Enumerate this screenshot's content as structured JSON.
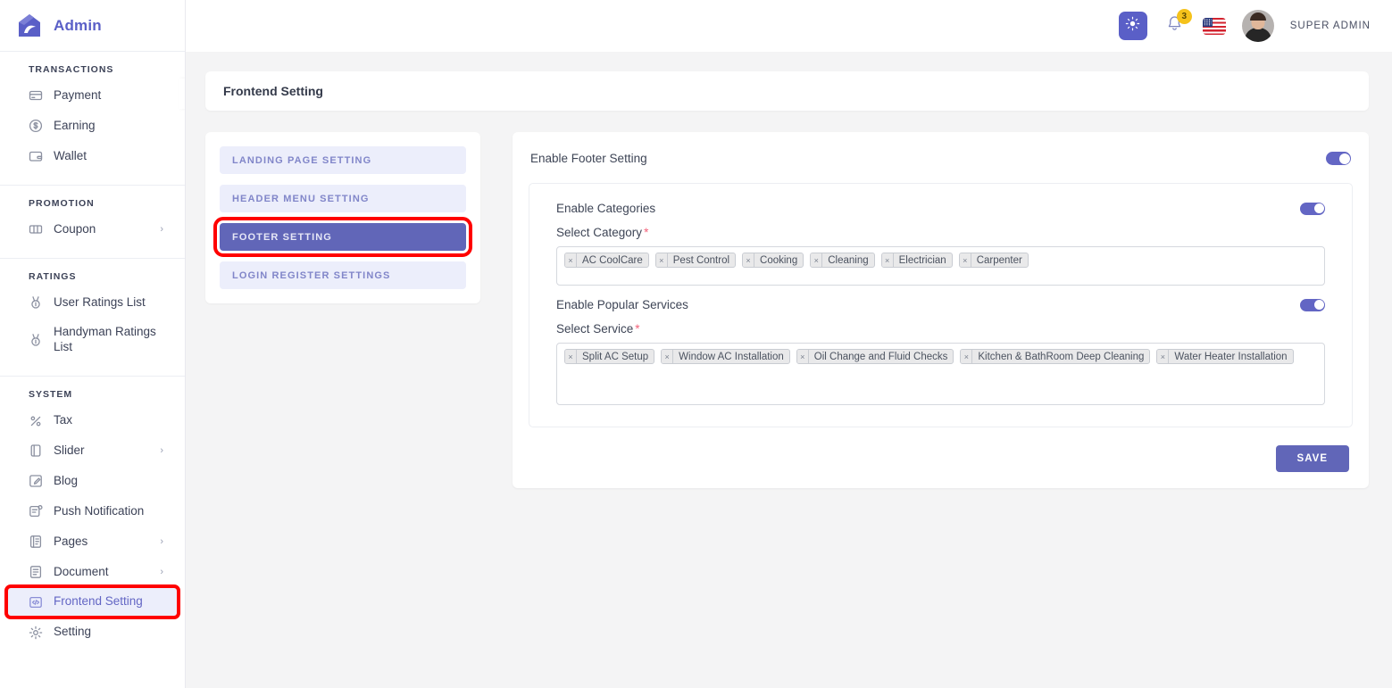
{
  "brand": {
    "name": "Admin",
    "logo_icon": "house-logo-icon"
  },
  "sidebar": {
    "collapse_icon": "chevron-left-icon",
    "groups": [
      {
        "title": "TRANSACTIONS",
        "items": [
          {
            "label": "Payment",
            "icon": "credit-card-icon",
            "caret": "",
            "state": ""
          },
          {
            "label": "Earning",
            "icon": "dollar-circle-icon",
            "caret": "",
            "state": ""
          },
          {
            "label": "Wallet",
            "icon": "wallet-icon",
            "caret": "",
            "state": ""
          }
        ]
      },
      {
        "title": "PROMOTION",
        "items": [
          {
            "label": "Coupon",
            "icon": "ticket-icon",
            "caret": "›",
            "state": ""
          }
        ]
      },
      {
        "title": "RATINGS",
        "items": [
          {
            "label": "User Ratings List",
            "icon": "medal-icon",
            "caret": "",
            "state": ""
          },
          {
            "label": "Handyman Ratings List",
            "icon": "medal-icon",
            "caret": "",
            "state": ""
          }
        ]
      },
      {
        "title": "SYSTEM",
        "items": [
          {
            "label": "Tax",
            "icon": "percent-icon",
            "caret": "",
            "state": ""
          },
          {
            "label": "Slider",
            "icon": "slider-icon",
            "caret": "›",
            "state": ""
          },
          {
            "label": "Blog",
            "icon": "blog-pencil-icon",
            "caret": "",
            "state": ""
          },
          {
            "label": "Push Notification",
            "icon": "push-notification-icon",
            "caret": "",
            "state": ""
          },
          {
            "label": "Pages",
            "icon": "pages-icon",
            "caret": "›",
            "state": ""
          },
          {
            "label": "Document",
            "icon": "document-icon",
            "caret": "›",
            "state": ""
          },
          {
            "label": "Frontend Setting",
            "icon": "code-window-icon",
            "caret": "",
            "state": "active highlighted"
          },
          {
            "label": "Setting",
            "icon": "gear-icon",
            "caret": "",
            "state": ""
          }
        ]
      }
    ]
  },
  "topbar": {
    "theme_icon": "sun-brightness-icon",
    "bell_icon": "bell-icon",
    "notification_count": "3",
    "flag_icon": "usa-flag-icon",
    "avatar_icon": "user-avatar",
    "user_name": "SUPER ADMIN"
  },
  "page": {
    "title": "Frontend Setting"
  },
  "tabs": [
    {
      "label": "LANDING PAGE SETTING",
      "state": ""
    },
    {
      "label": "HEADER MENU SETTING",
      "state": ""
    },
    {
      "label": "FOOTER SETTING",
      "state": "active highlighted"
    },
    {
      "label": "LOGIN REGISTER SETTINGS",
      "state": ""
    }
  ],
  "form": {
    "enable_footer_label": "Enable Footer Setting",
    "enable_footer_on": true,
    "enable_categories_label": "Enable Categories",
    "enable_categories_on": true,
    "select_category_label": "Select Category",
    "required_mark": "*",
    "categories": [
      "AC CoolCare",
      "Pest Control",
      "Cooking",
      "Cleaning",
      "Electrician",
      "Carpenter"
    ],
    "enable_popular_services_label": "Enable Popular Services",
    "enable_popular_services_on": true,
    "select_service_label": "Select Service",
    "services": [
      "Split AC Setup",
      "Window AC Installation",
      "Oil Change and Fluid Checks",
      "Kitchen & BathRoom Deep Cleaning",
      "Water Heater Installation"
    ],
    "chip_remove_icon": "×",
    "save_label": "SAVE"
  },
  "colors": {
    "accent": "#6166b8",
    "accent_light": "#eceefb",
    "badge": "#f5c21b",
    "required": "#f2637b",
    "highlight": "#ff0000",
    "page_bg": "#f4f4f5"
  }
}
